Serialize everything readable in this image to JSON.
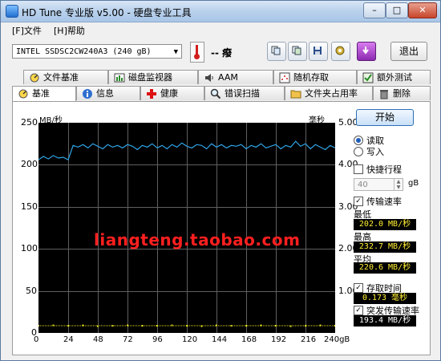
{
  "window": {
    "title": "HD Tune 专业版 v5.00 - 硬盘专业工具"
  },
  "menu": [
    {
      "label": "[F]文件"
    },
    {
      "label": "[H]帮助"
    }
  ],
  "toolbar": {
    "drive": "INTEL SSDSC2CW240A3 (240 gB)",
    "temperature": "-- 癈",
    "exit_label": "退出"
  },
  "tabs_top": [
    {
      "label": "文件基准",
      "icon": "benchmark-icon"
    },
    {
      "label": "磁盘监视器",
      "icon": "disk-monitor-icon"
    },
    {
      "label": "AAM",
      "icon": "speaker-icon"
    },
    {
      "label": "随机存取",
      "icon": "random-access-icon"
    },
    {
      "label": "额外测试",
      "icon": "extra-tests-icon"
    }
  ],
  "tabs_bottom": [
    {
      "label": "基准",
      "icon": "benchmark-icon",
      "active": true
    },
    {
      "label": "信息",
      "icon": "info-icon"
    },
    {
      "label": "健康",
      "icon": "health-cross-icon"
    },
    {
      "label": "错误扫描",
      "icon": "error-scan-icon"
    },
    {
      "label": "文件夹占用率",
      "icon": "folder-icon"
    },
    {
      "label": "删除",
      "icon": "trash-icon"
    }
  ],
  "controls": {
    "start_label": "开始",
    "read_label": "读取",
    "write_label": "写入",
    "mode_selected": "read",
    "quick_label": "快捷行程",
    "quick_checked": false,
    "quick_value": "40",
    "quick_unit": "gB",
    "transfer_label": "传输速率",
    "transfer_checked": true,
    "min_label": "最低",
    "min_value": "202.0 MB/秒",
    "max_label": "最高",
    "max_value": "232.7 MB/秒",
    "avg_label": "平均",
    "avg_value": "220.6 MB/秒",
    "access_label": "存取时间",
    "access_checked": true,
    "access_value": "0.173 毫秒",
    "burst_label": "突发传输速率",
    "burst_checked": true,
    "burst_value": "193.4 MB/秒"
  },
  "watermark": "liangteng.taobao.com",
  "chart_data": {
    "type": "line",
    "y_left_unit": "MB/秒",
    "y_right_unit": "毫秒",
    "y_left_ticks": [
      "250",
      "200",
      "150",
      "100",
      "50",
      "0"
    ],
    "y_right_ticks": [
      "5.00",
      "4.00",
      "3.00",
      "2.00",
      "1.00"
    ],
    "x_ticks": [
      "0",
      "24",
      "48",
      "72",
      "96",
      "120",
      "144",
      "168",
      "192",
      "216",
      "240gB"
    ],
    "ylim_left": [
      0,
      250
    ],
    "ylim_right": [
      0,
      5
    ],
    "xlim": [
      0,
      240
    ],
    "grid": true,
    "series": [
      {
        "role": "transfer-rate",
        "color": "#2ea3e6",
        "x": [
          0,
          4,
          8,
          12,
          16,
          20,
          24,
          28,
          32,
          36,
          40,
          44,
          48,
          52,
          56,
          60,
          64,
          68,
          72,
          76,
          80,
          84,
          88,
          92,
          96,
          100,
          104,
          108,
          112,
          116,
          120,
          124,
          128,
          132,
          136,
          140,
          144,
          148,
          152,
          156,
          160,
          164,
          168,
          172,
          176,
          180,
          184,
          188,
          192,
          196,
          200,
          204,
          208,
          212,
          216,
          220,
          224,
          228,
          232,
          236,
          240
        ],
        "y": [
          206,
          210,
          207,
          211,
          208,
          209,
          206,
          223,
          221,
          224,
          220,
          225,
          222,
          219,
          224,
          221,
          223,
          220,
          224,
          222,
          218,
          223,
          221,
          225,
          220,
          223,
          219,
          224,
          221,
          226,
          222,
          220,
          224,
          223,
          219,
          225,
          221,
          224,
          220,
          223,
          222,
          224,
          219,
          223,
          221,
          225,
          220,
          222,
          224,
          219,
          223,
          221,
          228,
          222,
          225,
          219,
          224,
          221,
          218,
          223,
          220
        ]
      },
      {
        "role": "access-time",
        "color": "#e6e31e",
        "x": [
          0,
          12,
          24,
          36,
          48,
          60,
          72,
          84,
          96,
          108,
          120,
          132,
          144,
          156,
          168,
          180,
          192,
          204,
          216,
          228,
          240
        ],
        "y_ms": [
          0.17,
          0.18,
          0.17,
          0.18,
          0.16,
          0.17,
          0.18,
          0.17,
          0.17,
          0.18,
          0.17,
          0.16,
          0.18,
          0.17,
          0.17,
          0.18,
          0.17,
          0.16,
          0.17,
          0.18,
          0.17
        ]
      }
    ]
  }
}
